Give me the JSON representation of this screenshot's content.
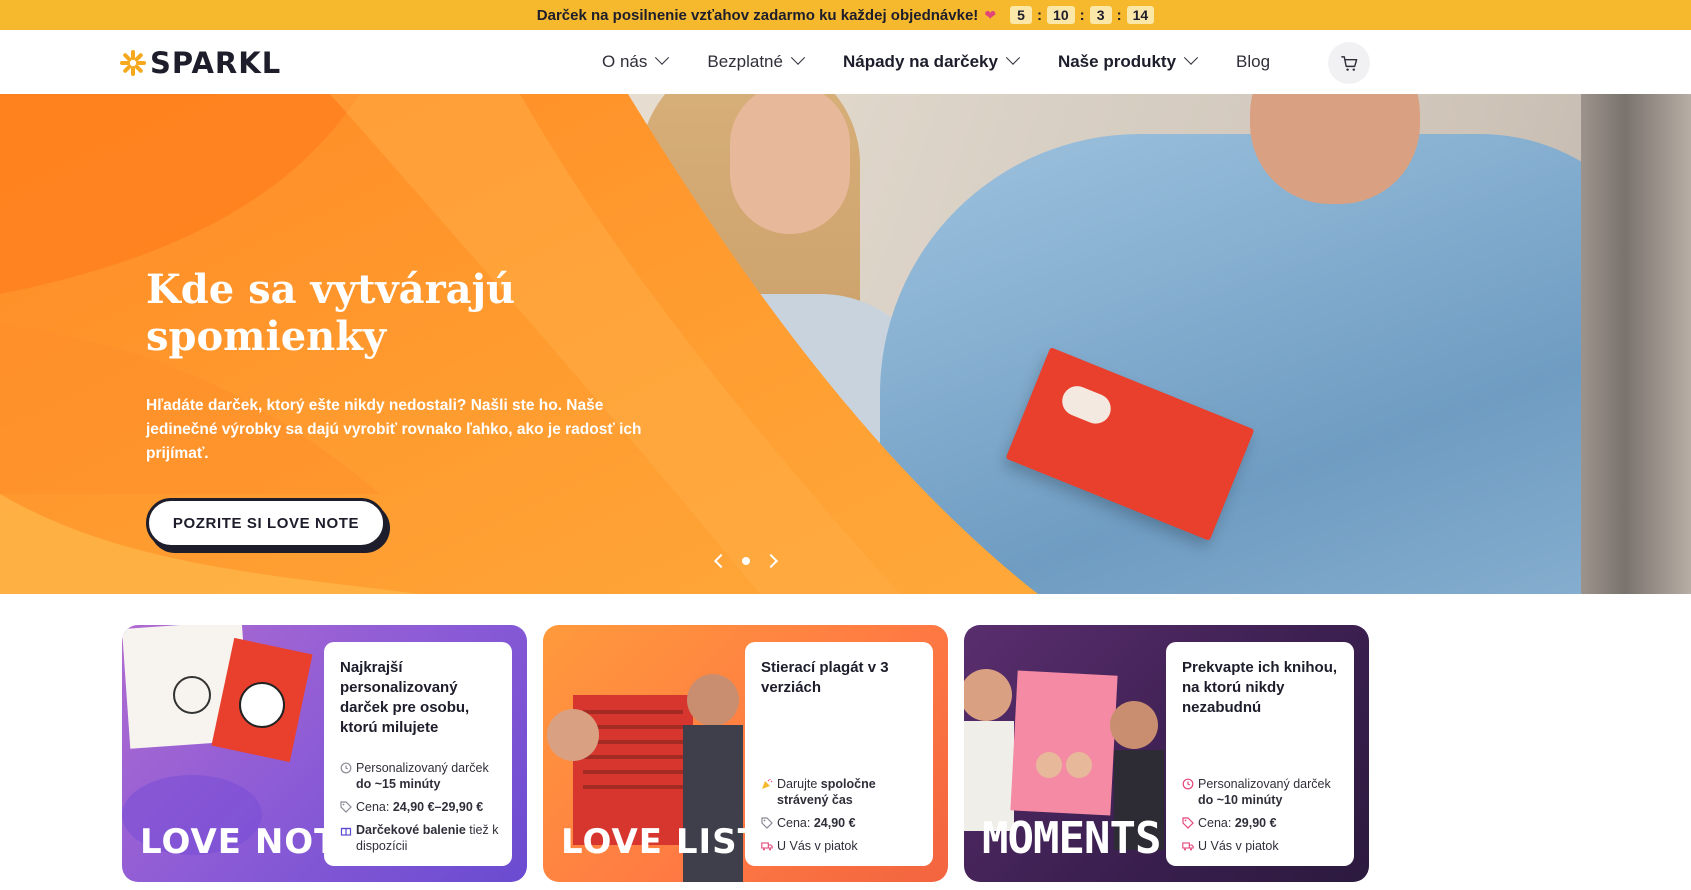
{
  "promo": {
    "text": "Darček na posilnenie vzťahov zadarmo ku každej objednávke!",
    "countdown": [
      "5",
      "10",
      "3",
      "14"
    ]
  },
  "header": {
    "logo": "SPARKL",
    "nav": [
      {
        "label": "O nás",
        "has_dropdown": true
      },
      {
        "label": "Bezplatné",
        "has_dropdown": true
      },
      {
        "label": "Nápady na darčeky",
        "has_dropdown": true
      },
      {
        "label": "Naše produkty",
        "has_dropdown": true
      },
      {
        "label": "Blog",
        "has_dropdown": false
      }
    ],
    "cart_icon": "cart-icon"
  },
  "hero": {
    "title": "Kde sa vytvárajú spomienky",
    "text": "Hľadáte darček, ktorý ešte nikdy nedostali? Našli ste ho. Naše jedinečné výrobky sa dajú vyrobiť rovnako ľahko, ako je radosť ich prijímať.",
    "button": "POZRITE SI LOVE NOTE"
  },
  "cards": [
    {
      "brand": "LOVE NOTE",
      "title": "Najkrajší personalizovaný darček pre osobu, ktorú milujete",
      "row1_a": "Personalizovaný darček",
      "row1_b": "do ~15 minúty",
      "row2_a": "Cena:",
      "row2_b": "24,90 €–29,90 €",
      "row3_a": "Darčekové balenie",
      "row3_b": "tiež k dispozícii"
    },
    {
      "brand": "LOVE LIST",
      "title": "Stierací plagát v 3 verziách",
      "row1_a": "Darujte",
      "row1_b": "spoločne strávený čas",
      "row2_a": "Cena:",
      "row2_b": "24,90 €",
      "row3_a": "U Vás v piatok",
      "row3_b": ""
    },
    {
      "brand": "MOMENTS",
      "title": "Prekvapte ich knihou, na ktorú nikdy nezabudnú",
      "row1_a": "Personalizovaný darček",
      "row1_b": "do ~10 minúty",
      "row2_a": "Cena:",
      "row2_b": "29,90 €",
      "row3_a": "U Vás v piatok",
      "row3_b": ""
    }
  ],
  "colors": {
    "promo_bar": "#f6b92e",
    "hero_orange": "#ff9b2f",
    "dark": "#1d1d2b"
  }
}
